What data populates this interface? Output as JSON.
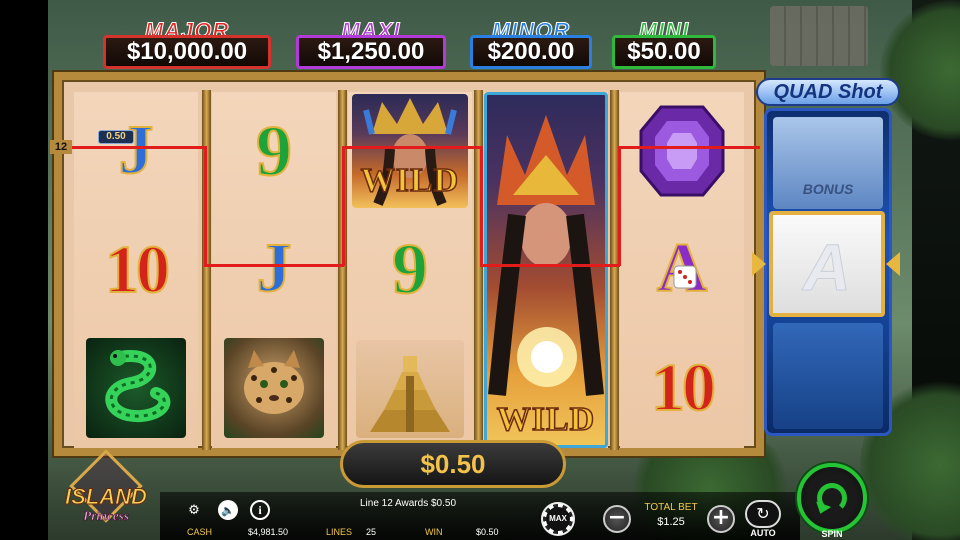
{
  "jackpots": {
    "major": {
      "title": "MAJOR",
      "amount": "$10,000.00"
    },
    "maxi": {
      "title": "MAXI",
      "amount": "$1,250.00"
    },
    "minor": {
      "title": "MINOR",
      "amount": "$200.00"
    },
    "mini": {
      "title": "MINI",
      "amount": "$50.00"
    }
  },
  "reels": {
    "reel1": [
      "J",
      "10",
      "snake"
    ],
    "reel2": [
      "9",
      "J",
      "ocelot"
    ],
    "reel3": [
      "princess-wild",
      "9",
      "pyramid"
    ],
    "reel4": [
      "expanded-wild-princess"
    ],
    "reel5": [
      "purple-gem",
      "A",
      "10"
    ],
    "wild_label": "WILD"
  },
  "symbols": {
    "j": "J",
    "nine": "9",
    "ten": "10",
    "ace": "A"
  },
  "payline": {
    "number": "12",
    "win_tag": "0.50",
    "color": "#e21b1b"
  },
  "quadshot": {
    "title": "QUAD Shot",
    "bonus": "BONUS",
    "symbol": "A"
  },
  "win_display": "$0.50",
  "logo": {
    "line1": "ISLAND",
    "line2": "Princess"
  },
  "status": {
    "line_award": "Line 12 Awards $0.50",
    "cash_label": "CASH",
    "cash_value": "$4,981.50",
    "lines_label": "LINES",
    "lines_value": "25",
    "win_label": "WIN",
    "win_value": "$0.50"
  },
  "controls": {
    "max_label": "MAX",
    "total_bet_label": "TOTAL BET",
    "total_bet_value": "$1.25",
    "minus": "−",
    "plus": "+",
    "auto_label": "AUTO",
    "spin_label": "SPIN"
  },
  "colors": {
    "major": "#e0241f",
    "maxi": "#b23ad6",
    "minor": "#2a7fe0",
    "mini": "#2fb83b",
    "spin": "#25c435"
  }
}
